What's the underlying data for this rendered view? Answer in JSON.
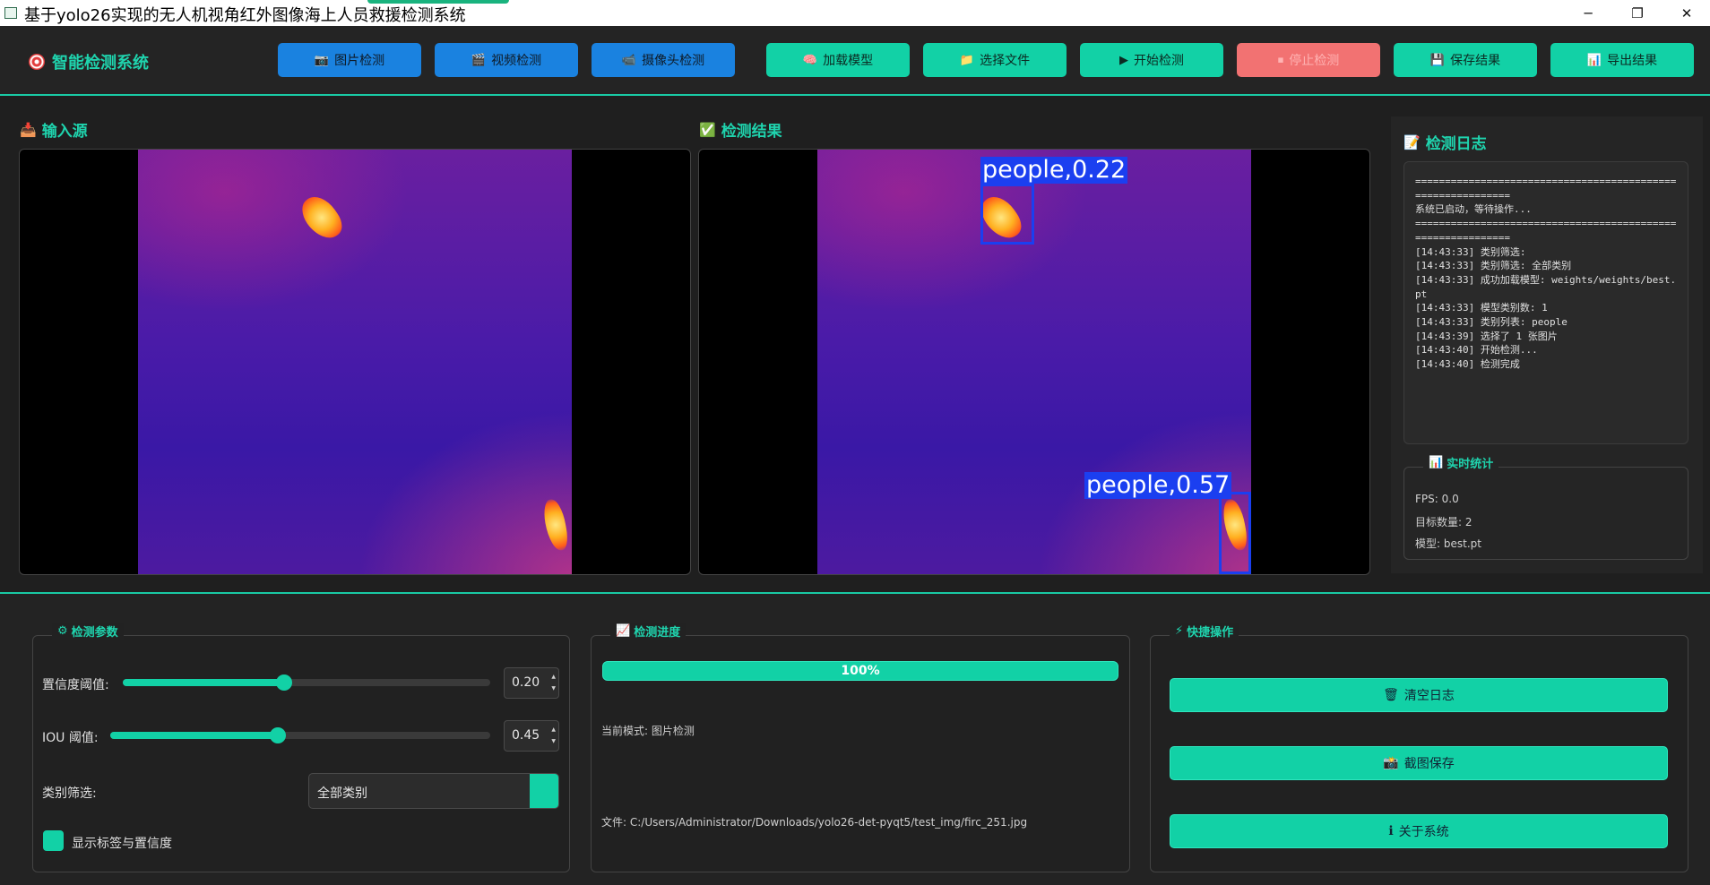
{
  "window": {
    "title": "基于yolo26实现的无人机视角红外图像海上人员救援检测系统",
    "minimize_glyph": "─",
    "maximize_glyph": "❐",
    "close_glyph": "✕"
  },
  "brand": {
    "label": "智能检测系统",
    "icon": "target-icon"
  },
  "toolbar": {
    "image_detect": "图片检测",
    "video_detect": "视频检测",
    "camera_detect": "摄像头检测",
    "load_model": "加载模型",
    "select_file": "选择文件",
    "start_detect": "开始检测",
    "stop_detect": "停止检测",
    "save_result": "保存结果",
    "export_result": "导出结果",
    "icons": {
      "image_detect": "📷",
      "video_detect": "🎬",
      "camera_detect": "📹",
      "load_model": "🧠",
      "select_file": "📁",
      "start_detect": "▶",
      "stop_detect": "⏹",
      "save_result": "💾",
      "export_result": "📊"
    }
  },
  "input_panel": {
    "title": "输入源",
    "icon": "📥"
  },
  "result_panel": {
    "title": "检测结果",
    "icon": "✅",
    "detections": [
      {
        "label": "people,0.22"
      },
      {
        "label": "people,0.57"
      }
    ]
  },
  "log_panel": {
    "title": "检测日志",
    "icon": "📝",
    "lines": [
      "============================================================",
      "系统已启动，等待操作...",
      "============================================================",
      "[14:43:33] 类别筛选:",
      "[14:43:33] 类别筛选: 全部类别",
      "[14:43:33] 成功加载模型: weights/weights/best.pt",
      "[14:43:33] 模型类别数: 1",
      "[14:43:33] 类别列表: people",
      "[14:43:39] 选择了 1 张图片",
      "[14:43:40] 开始检测...",
      "[14:43:40] 检测完成"
    ]
  },
  "stats": {
    "title": "实时统计",
    "icon": "📊",
    "fps": "FPS: 0.0",
    "targets": "目标数量: 2",
    "model": "模型: best.pt"
  },
  "params": {
    "title": "检测参数",
    "icon": "⚙",
    "confidence_label": "置信度阈值:",
    "confidence_value": "0.20",
    "confidence_level": 0.44,
    "iou_label": "IOU 阈值:",
    "iou_value": "0.45",
    "iou_level": 0.44,
    "class_filter_label": "类别筛选:",
    "class_filter_value": "全部类别",
    "show_labels": "显示标签与置信度"
  },
  "progress": {
    "title": "检测进度",
    "icon": "📈",
    "percent_text": "100%",
    "percent": 100,
    "mode": "当前模式: 图片检测",
    "file": "文件: C:/Users/Administrator/Downloads/yolo26-det-pyqt5/test_img/firc_251.jpg"
  },
  "quick": {
    "title": "快捷操作",
    "icon": "⚡",
    "clear_log": "清空日志",
    "screenshot": "截图保存",
    "about": "关于系统",
    "icons": {
      "clear_log": "🗑",
      "screenshot": "📸",
      "about": "ℹ"
    }
  }
}
